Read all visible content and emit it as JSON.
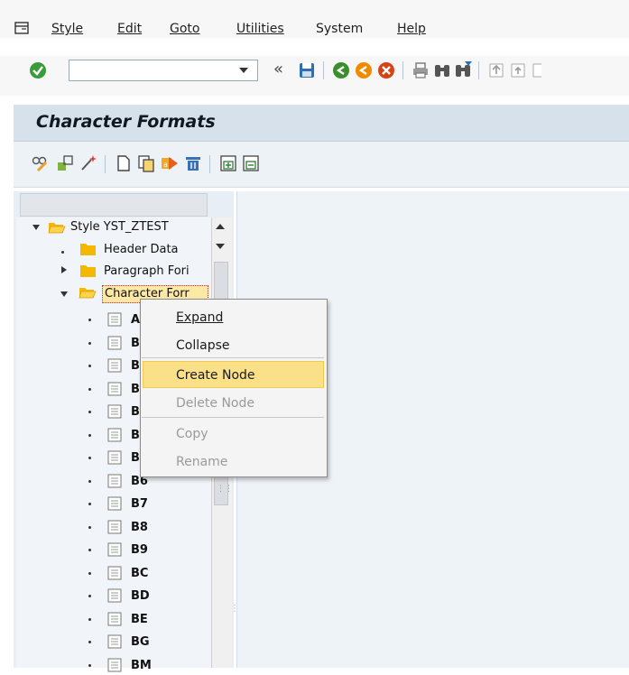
{
  "menubar": {
    "items": [
      "Style",
      "Edit",
      "Goto",
      "Utilities",
      "System",
      "Help"
    ]
  },
  "toolbar": {
    "command_value": ""
  },
  "screen": {
    "title": "Character Formats"
  },
  "tree": {
    "root": "Style YST_ZTEST",
    "header_data": "Header Data",
    "paragraph": "Paragraph Fori",
    "character": "Character Forr",
    "leaves": [
      "A",
      "B",
      "B",
      "B",
      "B",
      "B",
      "B",
      "B6",
      "B7",
      "B8",
      "B9",
      "BC",
      "BD",
      "BE",
      "BG",
      "BM"
    ]
  },
  "context_menu": {
    "items": [
      {
        "label": "Expand",
        "enabled": true
      },
      {
        "label": "Collapse",
        "enabled": true
      },
      {
        "label": "Create Node",
        "enabled": true,
        "highlighted": true
      },
      {
        "label": "Delete Node",
        "enabled": false
      },
      {
        "label": "Copy",
        "enabled": false
      },
      {
        "label": "Rename",
        "enabled": false
      }
    ]
  },
  "colors": {
    "title_bar": "#d6e1ec",
    "highlight": "#fbe08a",
    "folder": "#f5b800",
    "enter_green": "#3a9b3a",
    "back_green": "#3a8f2a",
    "exit_orange": "#f08a00",
    "cancel_red": "#d84315"
  }
}
